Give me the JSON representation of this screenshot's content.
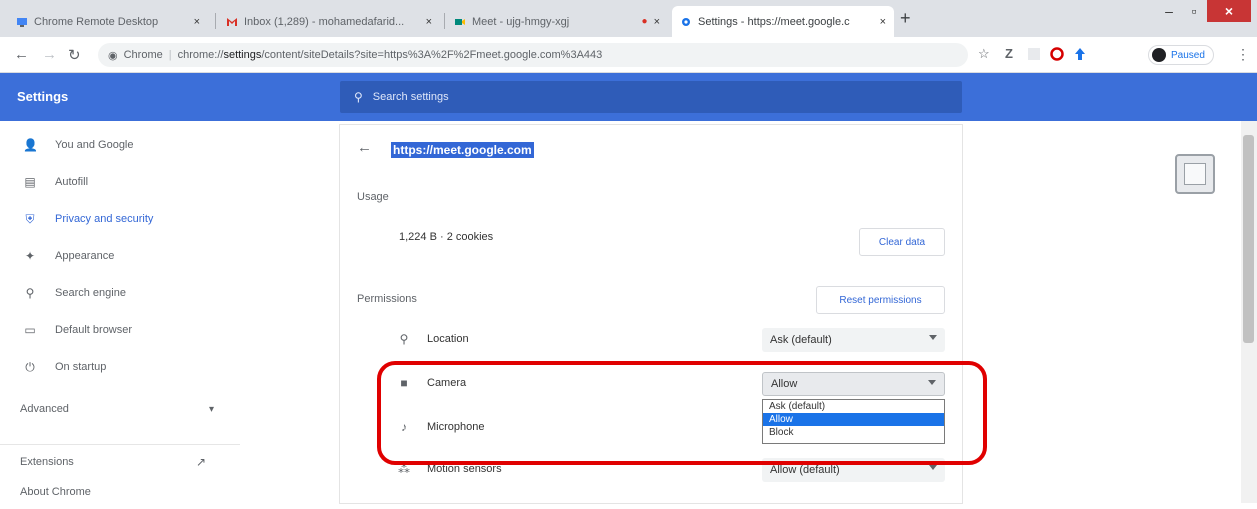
{
  "tabs": [
    {
      "title": "Chrome Remote Desktop",
      "close": "×"
    },
    {
      "title": "Inbox (1,289) - mohamedafarid...",
      "close": "×"
    },
    {
      "title": "Meet - ujg-hmgy-xgj",
      "close": "×"
    },
    {
      "title": "Settings - https://meet.google.c",
      "close": "×"
    }
  ],
  "new_tab": "+",
  "window": {
    "minimize": "–",
    "maximize": "▫",
    "close": "×"
  },
  "toolbar": {
    "secure_label": "Chrome",
    "url_prefix": "chrome://",
    "url_bold": "settings",
    "url_rest": "/content/siteDetails?site=https%3A%2F%2Fmeet.google.com%3A443",
    "profile_label": "Paused"
  },
  "header": {
    "title": "Settings",
    "search_placeholder": "Search settings"
  },
  "sidebar": {
    "items": [
      {
        "label": "You and Google",
        "icon": "person-icon"
      },
      {
        "label": "Autofill",
        "icon": "clipboard-icon"
      },
      {
        "label": "Privacy and security",
        "icon": "shield-icon"
      },
      {
        "label": "Appearance",
        "icon": "palette-icon"
      },
      {
        "label": "Search engine",
        "icon": "search-icon"
      },
      {
        "label": "Default browser",
        "icon": "browser-icon"
      },
      {
        "label": "On startup",
        "icon": "power-icon"
      }
    ],
    "advanced": "Advanced",
    "advanced_caret": "▾",
    "extensions": "Extensions",
    "about": "About Chrome"
  },
  "site": {
    "origin": "https://meet.google.com",
    "usage_label": "Usage",
    "storage_text": "1,224 B · 2 cookies",
    "clear_data": "Clear data",
    "permissions_label": "Permissions",
    "reset_permissions": "Reset permissions",
    "permissions": [
      {
        "label": "Location",
        "value": "Ask (default)",
        "icon": "location-pin-icon"
      },
      {
        "label": "Camera",
        "value": "Allow",
        "icon": "camera-icon"
      },
      {
        "label": "Microphone",
        "value": "",
        "icon": "microphone-icon"
      },
      {
        "label": "Motion sensors",
        "value": "Allow (default)",
        "icon": "motion-sensors-icon"
      }
    ]
  },
  "camera_dropdown": {
    "options": [
      "Ask (default)",
      "Allow",
      "Block"
    ],
    "selected": "Allow"
  },
  "colors": {
    "header_blue": "#3c6fd9",
    "accent": "#3367d6",
    "annotation_red": "#e00000"
  }
}
